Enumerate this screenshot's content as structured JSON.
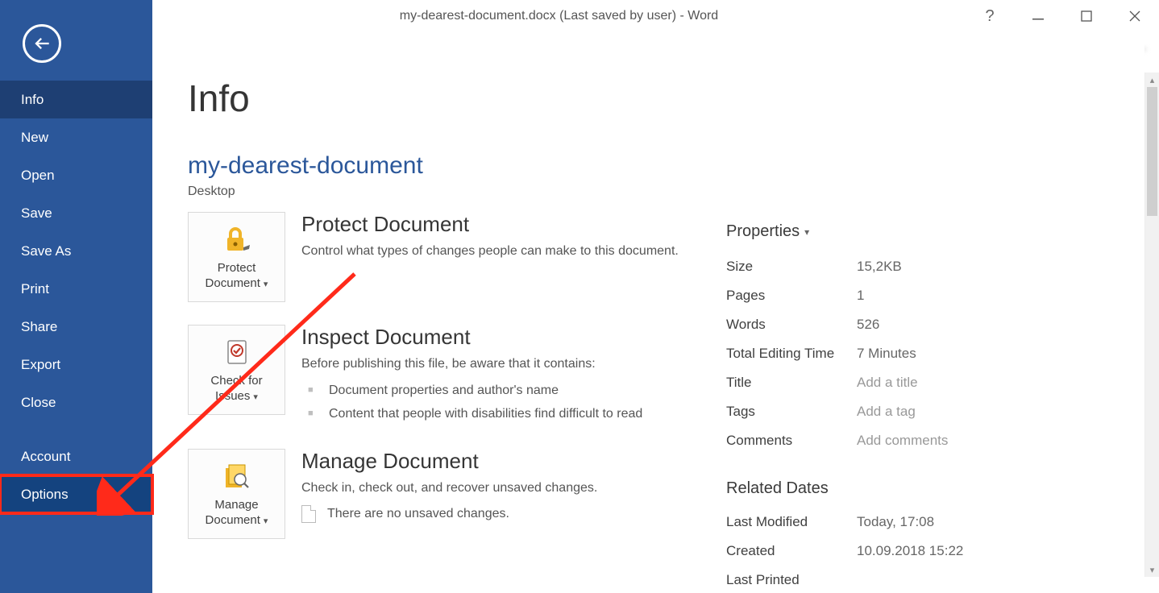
{
  "titlebar": {
    "title": "my-dearest-document.docx (Last saved by user) - Word"
  },
  "user_label": "———— ———",
  "sidebar": {
    "items": [
      {
        "id": "info",
        "label": "Info"
      },
      {
        "id": "new",
        "label": "New"
      },
      {
        "id": "open",
        "label": "Open"
      },
      {
        "id": "save",
        "label": "Save"
      },
      {
        "id": "saveas",
        "label": "Save As"
      },
      {
        "id": "print",
        "label": "Print"
      },
      {
        "id": "share",
        "label": "Share"
      },
      {
        "id": "export",
        "label": "Export"
      },
      {
        "id": "close",
        "label": "Close"
      },
      {
        "id": "account",
        "label": "Account"
      },
      {
        "id": "options",
        "label": "Options"
      }
    ]
  },
  "main": {
    "page_title": "Info",
    "doc_name": "my-dearest-document",
    "doc_location": "Desktop",
    "protect": {
      "btn_label": "Protect Document",
      "title": "Protect Document",
      "desc": "Control what types of changes people can make to this document."
    },
    "inspect": {
      "btn_label": "Check for Issues",
      "title": "Inspect Document",
      "desc": "Before publishing this file, be aware that it contains:",
      "bullets": [
        "Document properties and author's name",
        "Content that people with disabilities find difficult to read"
      ]
    },
    "manage": {
      "btn_label": "Manage Document",
      "title": "Manage Document",
      "desc": "Check in, check out, and recover unsaved changes.",
      "note": "There are no unsaved changes."
    }
  },
  "properties": {
    "heading": "Properties",
    "rows": [
      {
        "k": "Size",
        "v": "15,2KB"
      },
      {
        "k": "Pages",
        "v": "1"
      },
      {
        "k": "Words",
        "v": "526"
      },
      {
        "k": "Total Editing Time",
        "v": "7 Minutes"
      },
      {
        "k": "Title",
        "v": "Add a title",
        "ph": true
      },
      {
        "k": "Tags",
        "v": "Add a tag",
        "ph": true
      },
      {
        "k": "Comments",
        "v": "Add comments",
        "ph": true
      }
    ],
    "related_heading": "Related Dates",
    "related": [
      {
        "k": "Last Modified",
        "v": "Today, 17:08"
      },
      {
        "k": "Created",
        "v": "10.09.2018 15:22"
      },
      {
        "k": "Last Printed",
        "v": ""
      }
    ]
  }
}
